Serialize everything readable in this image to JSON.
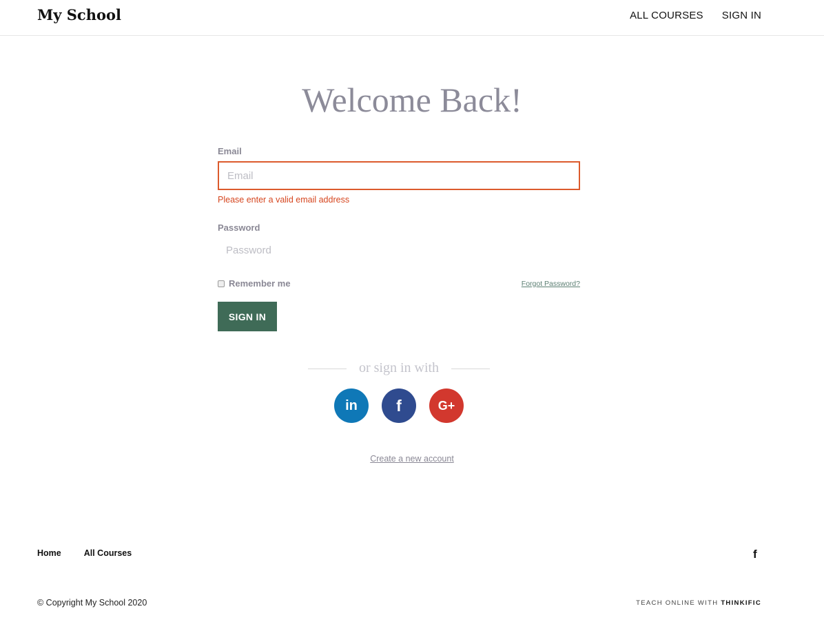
{
  "header": {
    "brand": "My School",
    "nav": [
      "ALL COURSES",
      "SIGN IN"
    ]
  },
  "main": {
    "title": "Welcome Back!",
    "email": {
      "label": "Email",
      "placeholder": "Email",
      "value": "",
      "error": "Please enter a valid email address"
    },
    "password": {
      "label": "Password",
      "placeholder": "Password",
      "value": ""
    },
    "remember_label": "Remember me",
    "remember_checked": false,
    "forgot_label": "Forgot Password?",
    "signin_label": "SIGN IN",
    "or_text": "or sign in with",
    "socials": [
      {
        "name": "linkedin",
        "glyph": "in",
        "color": "#0f78b7"
      },
      {
        "name": "facebook",
        "glyph": "f",
        "color": "#2f4b8f"
      },
      {
        "name": "google-plus",
        "glyph": "G+",
        "color": "#d2382e"
      }
    ],
    "create_label": "Create a new account"
  },
  "footer": {
    "links": [
      "Home",
      "All Courses"
    ],
    "social_glyph": "f",
    "copyright": "© Copyright My School 2020",
    "teach_prefix": "TEACH ONLINE WITH",
    "teach_brand": "THINKIFIC"
  },
  "colors": {
    "accent": "#3f6b57",
    "error": "#dc5a2c",
    "title": "#8c8b99"
  }
}
